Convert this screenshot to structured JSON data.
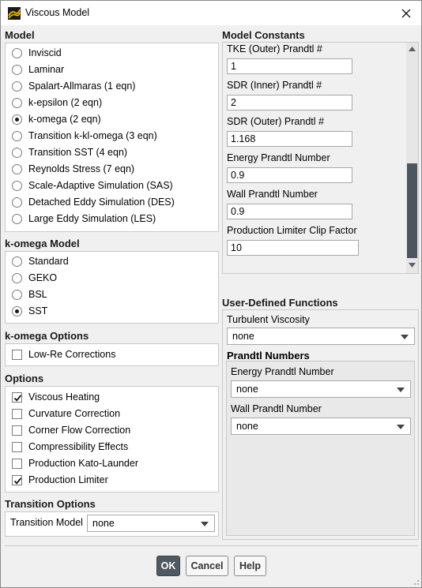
{
  "window": {
    "title": "Viscous Model"
  },
  "model": {
    "title": "Model",
    "options": [
      {
        "label": "Inviscid",
        "selected": false
      },
      {
        "label": "Laminar",
        "selected": false
      },
      {
        "label": "Spalart-Allmaras (1 eqn)",
        "selected": false
      },
      {
        "label": "k-epsilon (2 eqn)",
        "selected": false
      },
      {
        "label": "k-omega (2 eqn)",
        "selected": true
      },
      {
        "label": "Transition k-kl-omega (3 eqn)",
        "selected": false
      },
      {
        "label": "Transition SST (4 eqn)",
        "selected": false
      },
      {
        "label": "Reynolds Stress (7 eqn)",
        "selected": false
      },
      {
        "label": "Scale-Adaptive Simulation (SAS)",
        "selected": false
      },
      {
        "label": "Detached Eddy Simulation (DES)",
        "selected": false
      },
      {
        "label": "Large Eddy Simulation (LES)",
        "selected": false
      }
    ]
  },
  "komega_model": {
    "title": "k-omega Model",
    "options": [
      {
        "label": "Standard",
        "selected": false
      },
      {
        "label": "GEKO",
        "selected": false
      },
      {
        "label": "BSL",
        "selected": false
      },
      {
        "label": "SST",
        "selected": true
      }
    ]
  },
  "komega_options": {
    "title": "k-omega Options",
    "items": [
      {
        "label": "Low-Re Corrections",
        "checked": false
      }
    ]
  },
  "options": {
    "title": "Options",
    "items": [
      {
        "label": "Viscous Heating",
        "checked": true
      },
      {
        "label": "Curvature Correction",
        "checked": false
      },
      {
        "label": "Corner Flow Correction",
        "checked": false
      },
      {
        "label": "Compressibility Effects",
        "checked": false
      },
      {
        "label": "Production Kato-Launder",
        "checked": false
      },
      {
        "label": "Production Limiter",
        "checked": true
      }
    ]
  },
  "transition": {
    "title": "Transition Options",
    "model_label": "Transition Model",
    "model_value": "none"
  },
  "constants": {
    "title": "Model Constants",
    "items": [
      {
        "label": "TKE (Outer) Prandtl #",
        "value": "1"
      },
      {
        "label": "SDR (Inner) Prandtl #",
        "value": "2"
      },
      {
        "label": "SDR (Outer) Prandtl #",
        "value": "1.168"
      },
      {
        "label": "Energy Prandtl Number",
        "value": "0.9"
      },
      {
        "label": "Wall Prandtl Number",
        "value": "0.9"
      },
      {
        "label": "Production Limiter Clip Factor",
        "value": "10"
      }
    ],
    "scroll_position": 0.62
  },
  "udf": {
    "title": "User-Defined Functions",
    "turbulent_viscosity_label": "Turbulent Viscosity",
    "turbulent_viscosity_value": "none",
    "prandtl_title": "Prandtl Numbers",
    "energy_label": "Energy Prandtl Number",
    "energy_value": "none",
    "wall_label": "Wall Prandtl Number",
    "wall_value": "none"
  },
  "buttons": {
    "ok": "OK",
    "cancel": "Cancel",
    "help": "Help"
  },
  "colors": {
    "primary_button": "#4f5961",
    "scrollbar_thumb": "#4d565e"
  }
}
